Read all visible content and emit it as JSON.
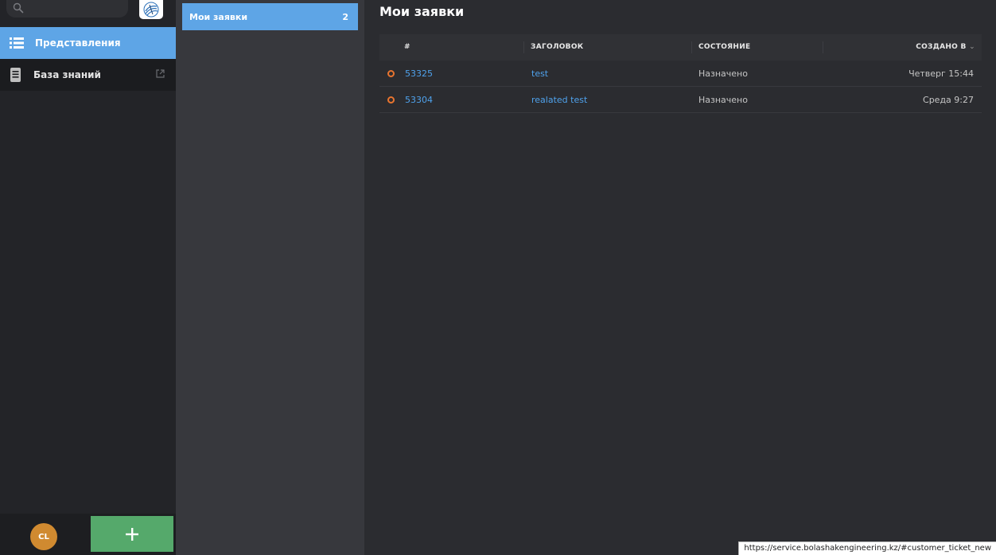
{
  "sidebar": {
    "items": [
      {
        "label": "Представления"
      },
      {
        "label": "База знаний"
      }
    ],
    "avatar_initials": "CL",
    "new_button_label": "+"
  },
  "overviews": {
    "items": [
      {
        "label": "Мои заявки",
        "count": "2"
      }
    ]
  },
  "main": {
    "title": "Мои заявки",
    "table": {
      "headers": [
        "#",
        "ЗАГОЛОВОК",
        "СОСТОЯНИЕ",
        "СОЗДАНО В"
      ],
      "sort_indicator": "⌄",
      "rows": [
        {
          "number": "53325",
          "title": "test",
          "state": "Назначено",
          "created": "Четверг 15:44"
        },
        {
          "number": "53304",
          "title": "realated test",
          "state": "Назначено",
          "created": "Среда 9:27"
        }
      ]
    }
  },
  "status_bar": {
    "url": "https://service.bolashakengineering.kz/#customer_ticket_new"
  },
  "colors": {
    "accent": "#5ea5e6",
    "link": "#4fa2ec",
    "status_open": "#e8742f",
    "new_button": "#55a96b",
    "avatar": "#d08a30"
  },
  "icons": [
    "search-icon",
    "logo-icon",
    "list-icon",
    "book-icon",
    "external-link-icon",
    "plus-icon",
    "status-circle-icon",
    "chevron-down-icon"
  ]
}
